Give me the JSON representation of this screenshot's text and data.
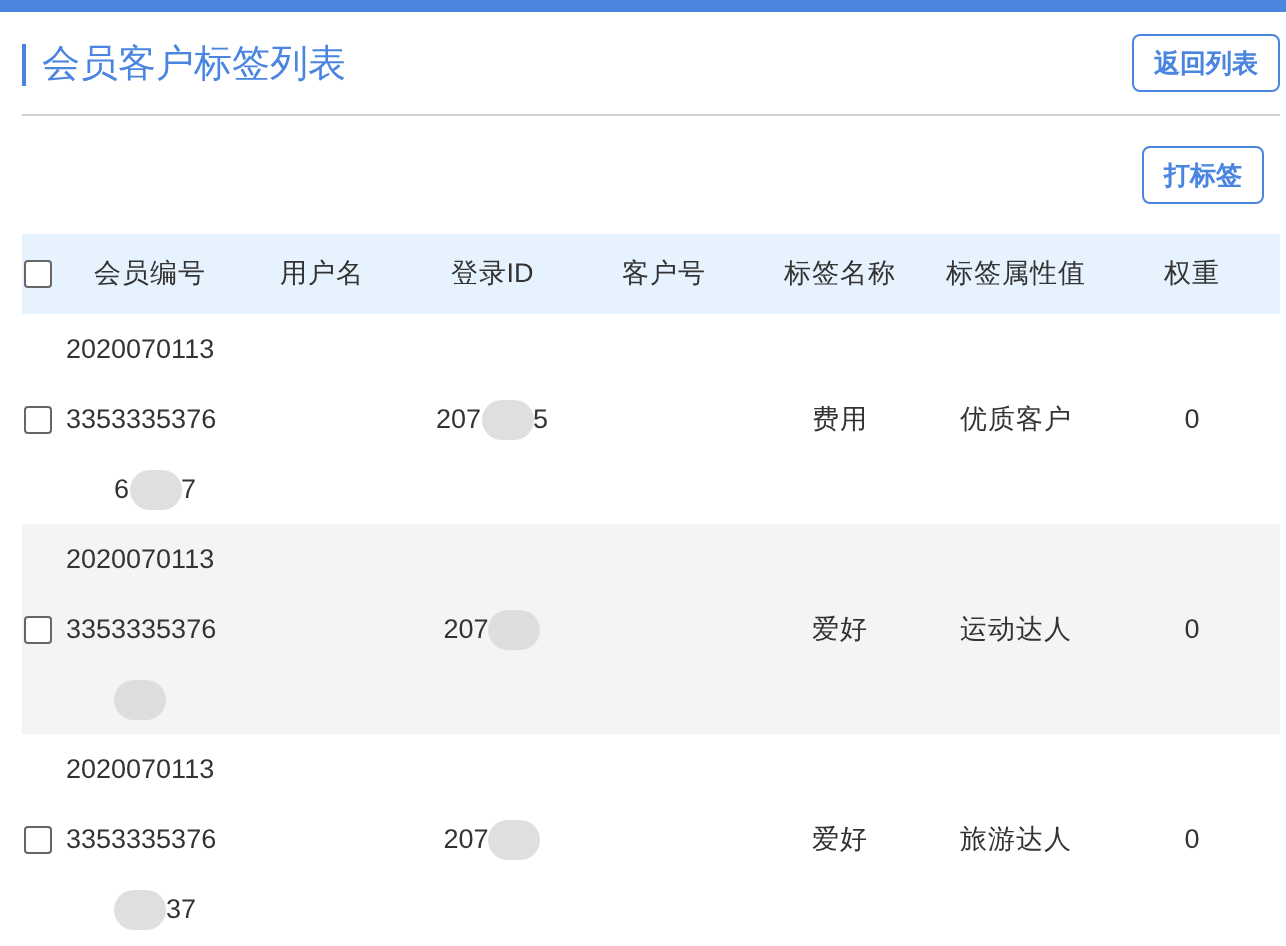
{
  "title": "会员客户标签列表",
  "back_button": "返回列表",
  "tag_button": "打标签",
  "table": {
    "select_all": {
      "checked": false
    },
    "columns": [
      "会员编号",
      "用户名",
      "登录ID",
      "客户号",
      "标签名称",
      "标签属性值",
      "权重"
    ],
    "rows": [
      {
        "checked": false,
        "member_no": [
          "2020070113",
          "3353335376"
        ],
        "member_tail": [
          {
            "kind": "text",
            "text": "6"
          },
          {
            "kind": "blur"
          },
          {
            "kind": "text",
            "text": "7"
          }
        ],
        "login_id": [
          {
            "kind": "text",
            "text": "207"
          },
          {
            "kind": "blur"
          },
          {
            "kind": "text",
            "text": "5"
          }
        ],
        "tag_name": "费用",
        "tag_value": "优质客户",
        "weight": "0"
      },
      {
        "checked": false,
        "member_no": [
          "2020070113",
          "3353335376"
        ],
        "member_tail": [
          {
            "kind": "blur"
          }
        ],
        "login_id": [
          {
            "kind": "text",
            "text": "207"
          },
          {
            "kind": "blur"
          }
        ],
        "tag_name": "爱好",
        "tag_value": "运动达人",
        "weight": "0"
      },
      {
        "checked": false,
        "member_no": [
          "2020070113",
          "3353335376"
        ],
        "member_tail": [
          {
            "kind": "blur"
          },
          {
            "kind": "text",
            "text": "37"
          }
        ],
        "login_id": [
          {
            "kind": "text",
            "text": "207"
          },
          {
            "kind": "blur"
          }
        ],
        "tag_name": "爱好",
        "tag_value": "旅游达人",
        "weight": "0"
      }
    ]
  }
}
